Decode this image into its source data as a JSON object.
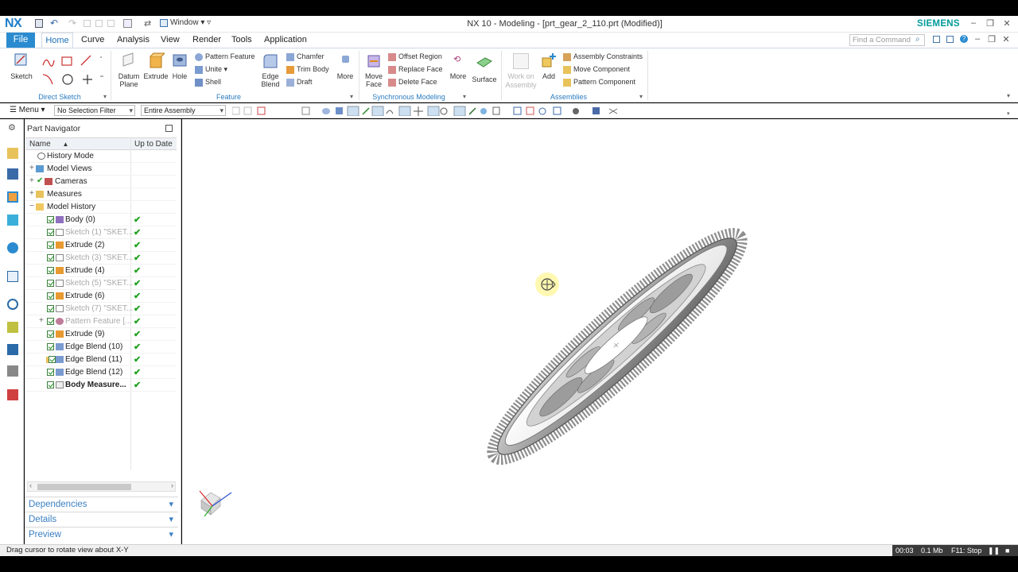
{
  "window": {
    "logo": "NX",
    "window_menu": "Window",
    "title": "NX 10 - Modeling - [prt_gear_2_110.prt (Modified)]",
    "brand": "SIEMENS"
  },
  "ribbon_tabs": {
    "file": "File",
    "tabs": [
      "Home",
      "Curve",
      "Analysis",
      "View",
      "Render",
      "Tools",
      "Application"
    ],
    "active": "Home",
    "find_placeholder": "Find a Command"
  },
  "ribbon": {
    "direct_sketch": {
      "label": "Direct Sketch",
      "sketch": "Sketch"
    },
    "feature": {
      "label": "Feature",
      "datum_plane": [
        "Datum",
        "Plane"
      ],
      "extrude": "Extrude",
      "hole": "Hole",
      "pattern_feature": "Pattern Feature",
      "unite": "Unite",
      "shell": "Shell",
      "edge_blend": [
        "Edge",
        "Blend"
      ],
      "chamfer": "Chamfer",
      "trim_body": "Trim Body",
      "draft": "Draft",
      "more": "More"
    },
    "synchronous": {
      "label": "Synchronous Modeling",
      "move_face": [
        "Move",
        "Face"
      ],
      "offset_region": "Offset Region",
      "replace_face": "Replace Face",
      "delete_face": "Delete Face",
      "more": "More",
      "surface": "Surface"
    },
    "assemblies": {
      "label": "Assemblies",
      "work_on_assembly": [
        "Work on",
        "Assembly"
      ],
      "add": "Add",
      "assembly_constraints": "Assembly Constraints",
      "move_component": "Move Component",
      "pattern_component": "Pattern Component"
    }
  },
  "toolbar": {
    "menu": "Menu",
    "selection_filter": "No Selection Filter",
    "scope": "Entire Assembly"
  },
  "navigator": {
    "title": "Part Navigator",
    "col_name": "Name",
    "col_uptodate": "Up to Date",
    "items": [
      {
        "label": "History Mode",
        "ok": ""
      },
      {
        "label": "Model Views",
        "ok": ""
      },
      {
        "label": "Cameras",
        "ok": ""
      },
      {
        "label": "Measures",
        "ok": ""
      },
      {
        "label": "Model History",
        "ok": ""
      },
      {
        "label": "Body (0)",
        "ok": "✔"
      },
      {
        "label": "Sketch (1) \"SKET...",
        "ok": "✔"
      },
      {
        "label": "Extrude (2)",
        "ok": "✔"
      },
      {
        "label": "Sketch (3) \"SKET...",
        "ok": "✔"
      },
      {
        "label": "Extrude (4)",
        "ok": "✔"
      },
      {
        "label": "Sketch (5) \"SKET...",
        "ok": "✔"
      },
      {
        "label": "Extrude (6)",
        "ok": "✔"
      },
      {
        "label": "Sketch (7) \"SKET...",
        "ok": "✔"
      },
      {
        "label": "Pattern Feature [...",
        "ok": "✔"
      },
      {
        "label": "Extrude (9)",
        "ok": "✔"
      },
      {
        "label": "Edge Blend (10)",
        "ok": "✔"
      },
      {
        "label": "Edge Blend (11)",
        "ok": "✔"
      },
      {
        "label": "Edge Blend (12)",
        "ok": "✔"
      },
      {
        "label": "Body Measure...",
        "ok": "✔"
      }
    ],
    "panels": [
      "Dependencies",
      "Details",
      "Preview"
    ]
  },
  "status": {
    "message": "Drag cursor to rotate view about X-Y",
    "rec_time": "00:03",
    "rec_size": "0.1 Mb",
    "rec_stop": "F11: Stop"
  },
  "colors": {
    "accent": "#2a8bd0",
    "brand": "#009999",
    "ok_green": "#20a020"
  }
}
